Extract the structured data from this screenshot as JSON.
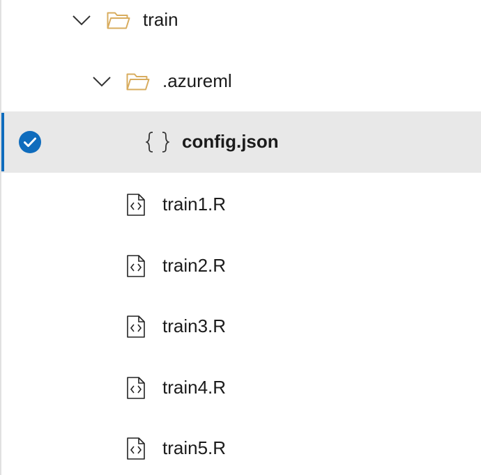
{
  "tree": {
    "root_folder": {
      "label": "train",
      "icon": "folder-open-icon",
      "expanded": true
    },
    "sub_folder": {
      "label": ".azureml",
      "icon": "folder-open-icon",
      "expanded": true
    },
    "selected_file": {
      "label": "config.json",
      "icon": "json-braces-icon",
      "selected": true
    },
    "files": [
      {
        "label": "train1.R",
        "icon": "code-file-icon"
      },
      {
        "label": "train2.R",
        "icon": "code-file-icon"
      },
      {
        "label": "train3.R",
        "icon": "code-file-icon"
      },
      {
        "label": "train4.R",
        "icon": "code-file-icon"
      },
      {
        "label": "train5.R",
        "icon": "code-file-icon"
      }
    ]
  },
  "colors": {
    "selection_bg": "#e8e8e8",
    "selection_bar": "#0f6cbd",
    "check_fill": "#0f6cbd",
    "folder": "#d8ac5e",
    "text": "#1b1b1b"
  }
}
